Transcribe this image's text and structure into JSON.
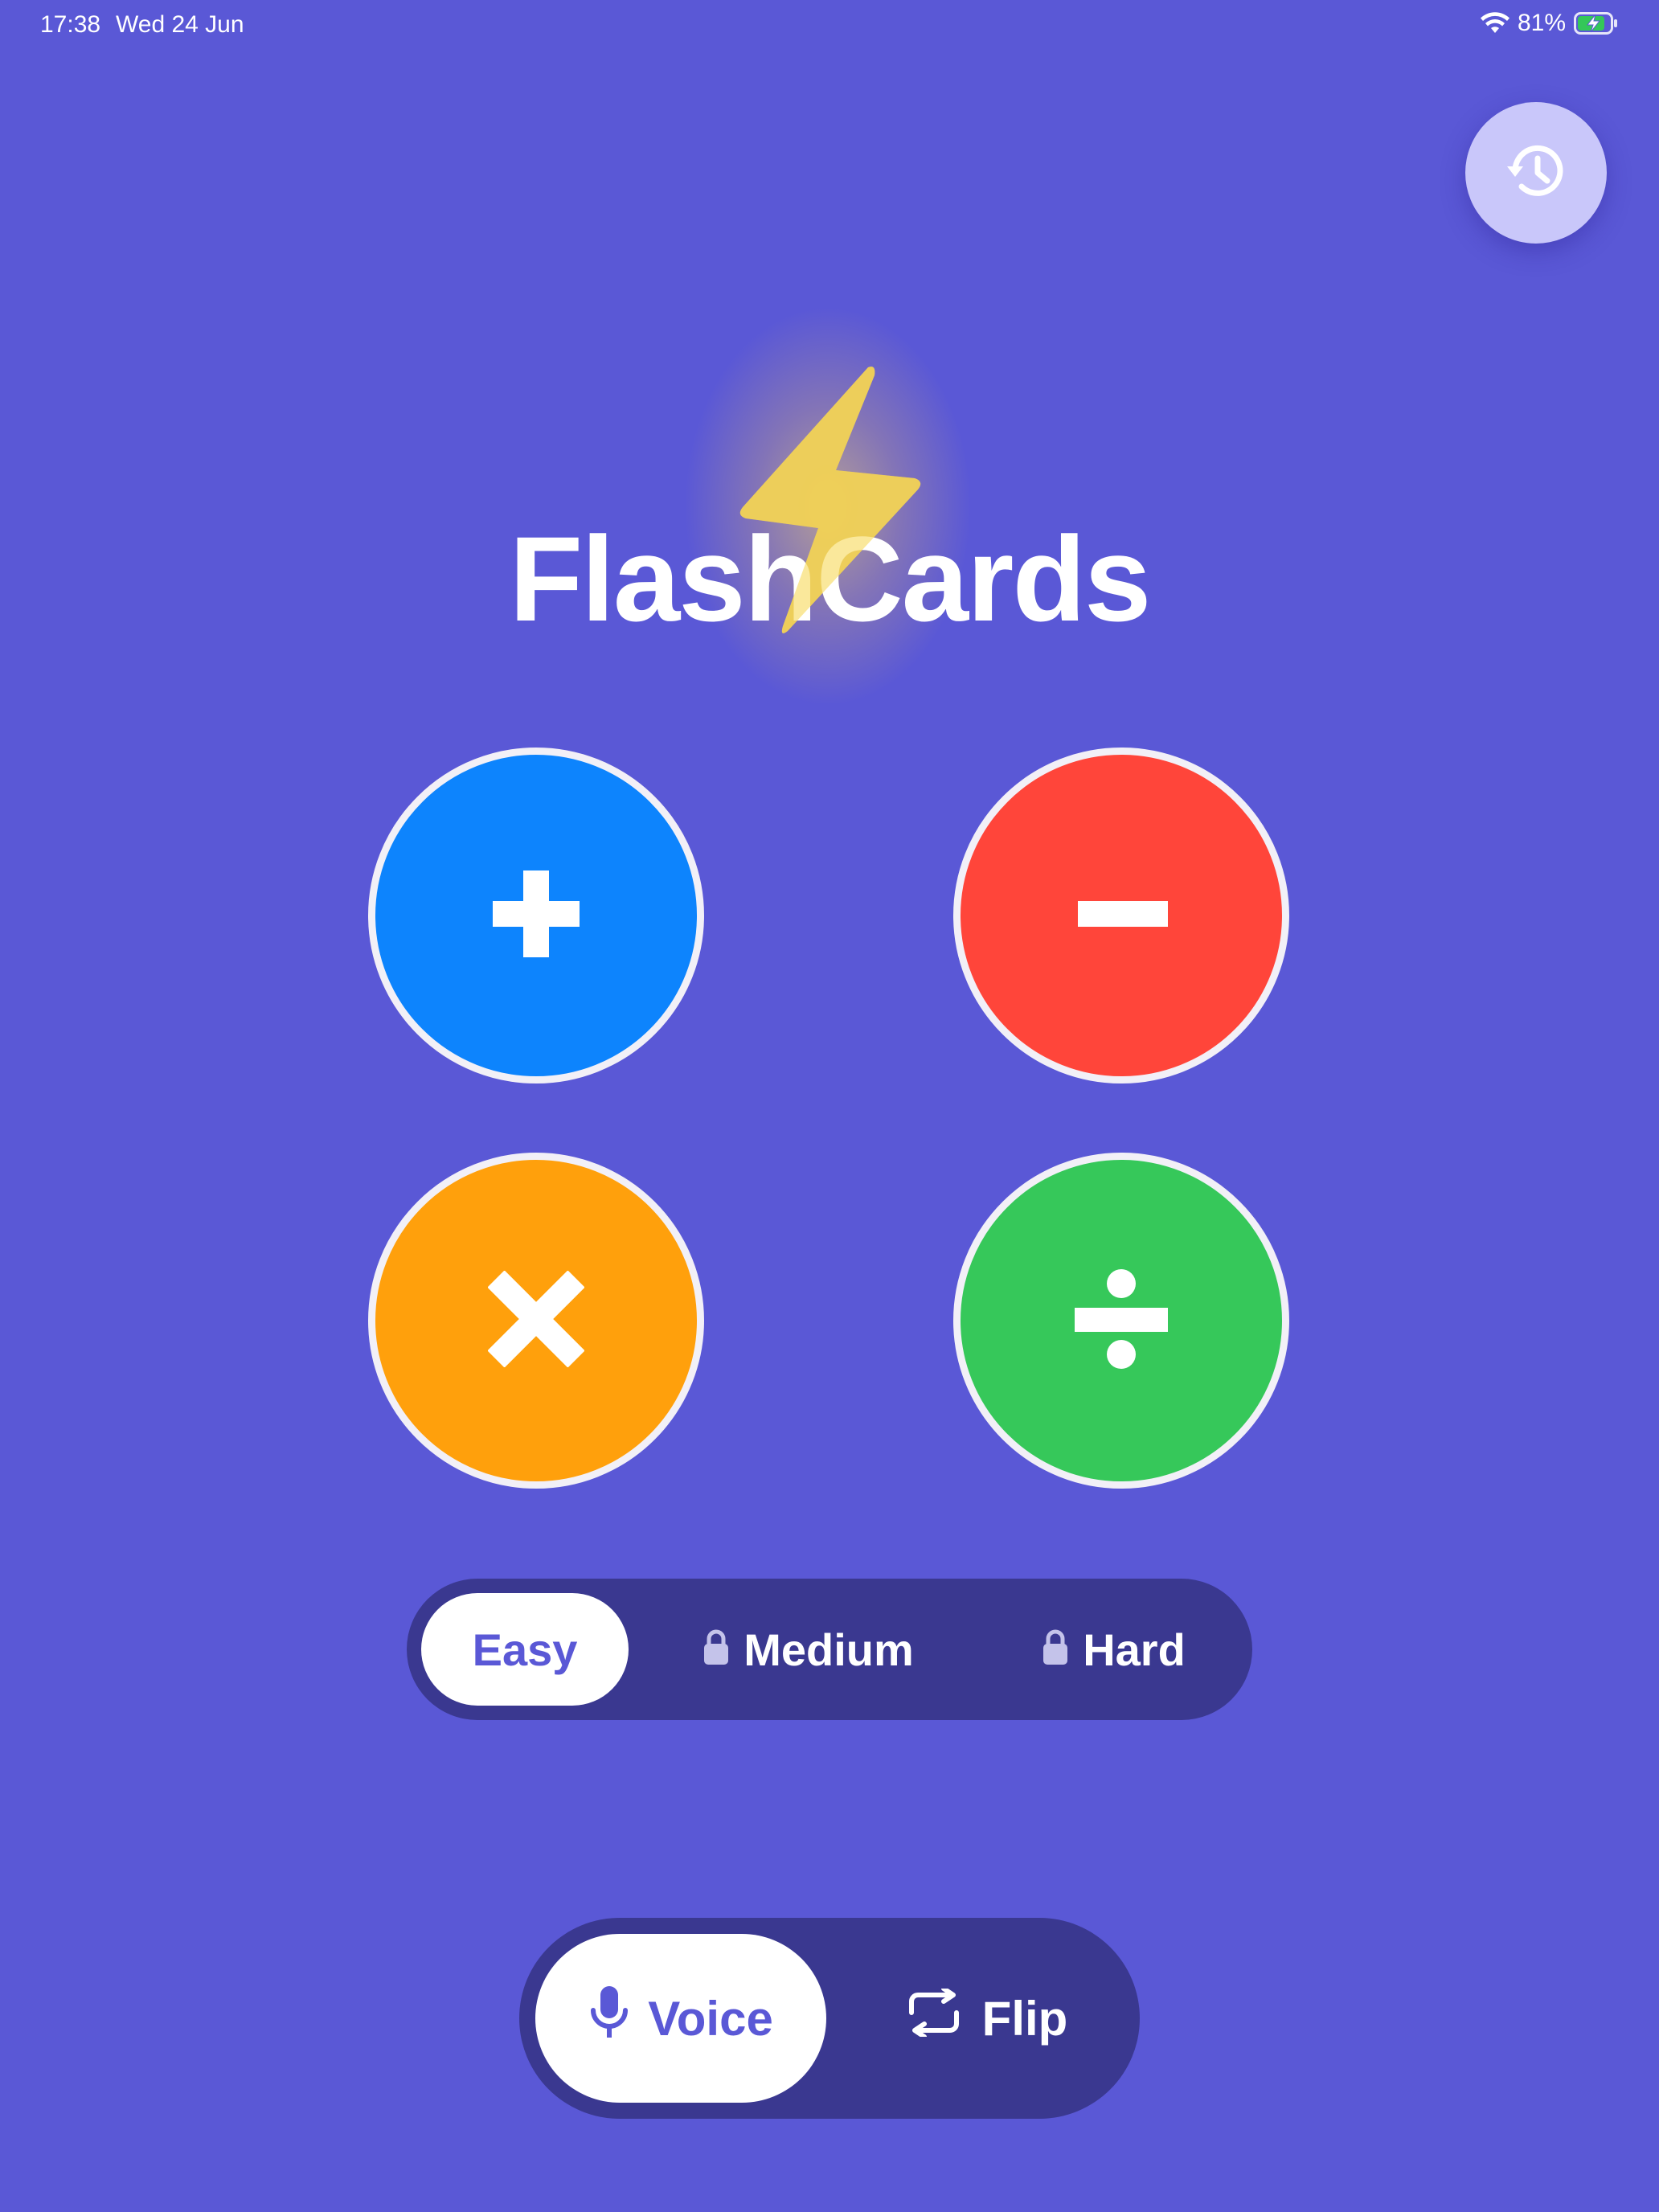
{
  "status_bar": {
    "time": "17:38",
    "date": "Wed 24 Jun",
    "battery_percent": "81%",
    "wifi_icon": "wifi-icon",
    "battery_icon": "battery-charging-icon"
  },
  "header": {
    "history_icon": "history-clock-icon"
  },
  "logo": {
    "title": "FlashCards",
    "icon": "lightning-bolt-icon",
    "bolt_color": "#F4D35E"
  },
  "operations": [
    {
      "symbol": "+",
      "icon": "plus-icon",
      "color": "#0D84FD"
    },
    {
      "symbol": "−",
      "icon": "minus-icon",
      "color": "#FF453A"
    },
    {
      "symbol": "×",
      "icon": "multiply-icon",
      "color": "#FFA00C"
    },
    {
      "symbol": "÷",
      "icon": "divide-icon",
      "color": "#36C85A"
    }
  ],
  "difficulty": {
    "options": [
      {
        "label": "Easy",
        "locked": false,
        "selected": true
      },
      {
        "label": "Medium",
        "locked": true,
        "selected": false
      },
      {
        "label": "Hard",
        "locked": true,
        "selected": false
      }
    ]
  },
  "mode": {
    "options": [
      {
        "label": "Voice",
        "icon": "microphone-icon",
        "selected": true
      },
      {
        "label": "Flip",
        "icon": "flip-repeat-icon",
        "selected": false
      }
    ]
  },
  "colors": {
    "background": "#5A58D6",
    "control_track": "#3A3890",
    "history_button": "#C9C7FA",
    "selected_text": "#5A58D6"
  }
}
